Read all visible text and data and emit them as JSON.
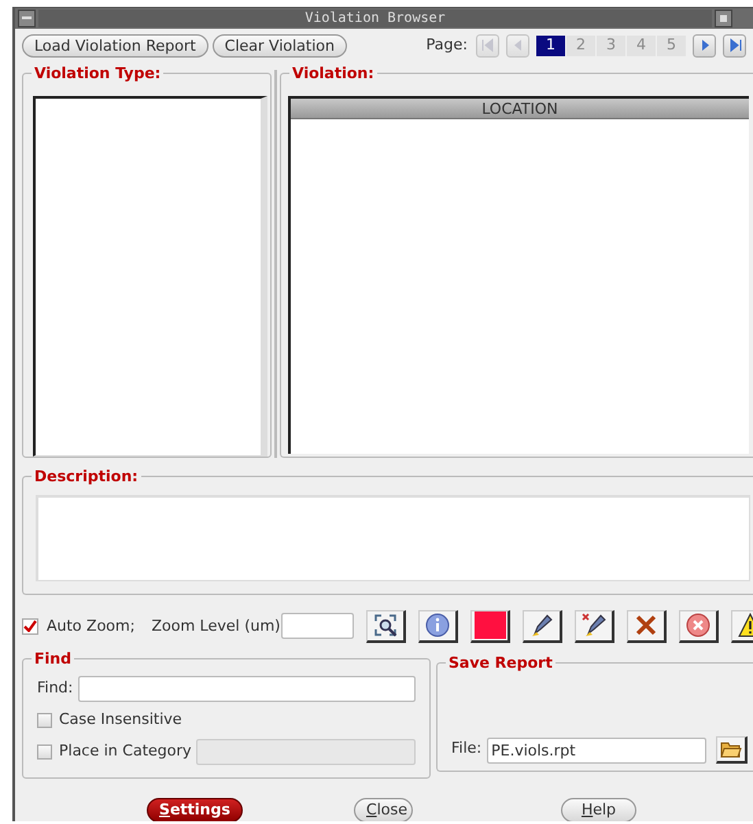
{
  "window": {
    "title": "Violation Browser"
  },
  "toolbar": {
    "buttons": [
      "Load Violation Report",
      "Clear Violation"
    ]
  },
  "pager": {
    "label": "Page:",
    "nav": [
      {
        "kind": "first",
        "disabled": true
      },
      {
        "kind": "prev",
        "disabled": true
      }
    ],
    "pages": [
      {
        "label": "1",
        "selected": true
      },
      {
        "label": "2",
        "selected": false
      },
      {
        "label": "3",
        "selected": false
      },
      {
        "label": "4",
        "selected": false
      },
      {
        "label": "5",
        "selected": false
      }
    ],
    "nav_after": [
      {
        "kind": "next",
        "disabled": false
      },
      {
        "kind": "last",
        "disabled": false
      }
    ]
  },
  "violation_type": {
    "title": "Violation Type:"
  },
  "violation": {
    "title": "Violation:",
    "columns": [
      "LOCATION"
    ]
  },
  "description": {
    "title": "Description:"
  },
  "zoom": {
    "auto_zoom": {
      "label": "Auto Zoom;",
      "checked": true
    },
    "level_label": "Zoom Level (um)"
  },
  "tools": [
    {
      "kind": "zoom-fit"
    },
    {
      "kind": "info"
    },
    {
      "kind": "color",
      "color": "#ff1040"
    },
    {
      "kind": "pen"
    },
    {
      "kind": "pen-x"
    },
    {
      "kind": "delete"
    },
    {
      "kind": "stop"
    },
    {
      "kind": "warning"
    }
  ],
  "find": {
    "title": "Find",
    "label": "Find:",
    "options": [
      {
        "label": "Case Insensitive",
        "checked": false
      },
      {
        "label": "Place in Category",
        "checked": false
      }
    ]
  },
  "save_report": {
    "title": "Save Report",
    "label": "File:",
    "value": "PE.viols.rpt"
  },
  "footer": [
    {
      "label": "Settings",
      "primary": true
    },
    {
      "label": "Close",
      "primary": false
    },
    {
      "label": "Help",
      "primary": false
    }
  ]
}
